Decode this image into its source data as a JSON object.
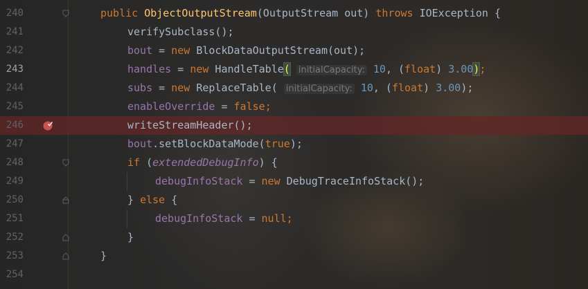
{
  "editor": {
    "colors": {
      "background": "#2b2b2b",
      "keyword": "#cc7832",
      "method_decl": "#ffc66d",
      "field": "#9876aa",
      "number": "#6897bb",
      "text": "#a9b7c6",
      "line_number": "#5f6266",
      "breakpoint_line": "#652525"
    },
    "current_line": "243",
    "breakpoint_line": "246",
    "lines": [
      {
        "num": "240",
        "t1": "public",
        "t2": "ObjectOutputStream",
        "t3": "(OutputStream out) ",
        "t4": "throws",
        "t5": " IOException {"
      },
      {
        "num": "241",
        "t1": "verifySubclass();"
      },
      {
        "num": "242",
        "t1": "bout",
        "t2": " = ",
        "t3": "new",
        "t4": " BlockDataOutputStream(out);"
      },
      {
        "num": "243",
        "t1": "handles",
        "t2": " = ",
        "t3": "new",
        "t4": " HandleTable",
        "paren_open": "(",
        "hint": "initialCapacity:",
        "v1": "10",
        "sep": ", (",
        "kwf": "float",
        "close": ") ",
        "v2": "3.00",
        "paren_close": ")",
        "end": ";"
      },
      {
        "num": "244",
        "t1": "subs",
        "t2": " = ",
        "t3": "new",
        "t4": " ReplaceTable( ",
        "hint": "initialCapacity:",
        "v1": "10",
        "sep": ", (",
        "kwf": "float",
        "close": ") ",
        "v2": "3.00",
        "end": ");"
      },
      {
        "num": "245",
        "t1": "enableOverride",
        "t2": " = ",
        "t3": "false",
        "t4": ";"
      },
      {
        "num": "246",
        "t1": "writeStreamHeader();"
      },
      {
        "num": "247",
        "t1": "bout",
        "t2": ".setBlockDataMode(",
        "t3": "true",
        "t4": ");"
      },
      {
        "num": "248",
        "t1": "if",
        "t2": " (",
        "t3": "extendedDebugInfo",
        "t4": ") {"
      },
      {
        "num": "249",
        "t1": "debugInfoStack",
        "t2": " = ",
        "t3": "new",
        "t4": " DebugTraceInfoStack();"
      },
      {
        "num": "250",
        "t1": "} ",
        "t2": "else",
        "t3": " {"
      },
      {
        "num": "251",
        "t1": "debugInfoStack",
        "t2": " = ",
        "t3": "null",
        "t4": ";"
      },
      {
        "num": "252",
        "t1": "}"
      },
      {
        "num": "253",
        "t1": "}"
      },
      {
        "num": "254"
      }
    ]
  }
}
